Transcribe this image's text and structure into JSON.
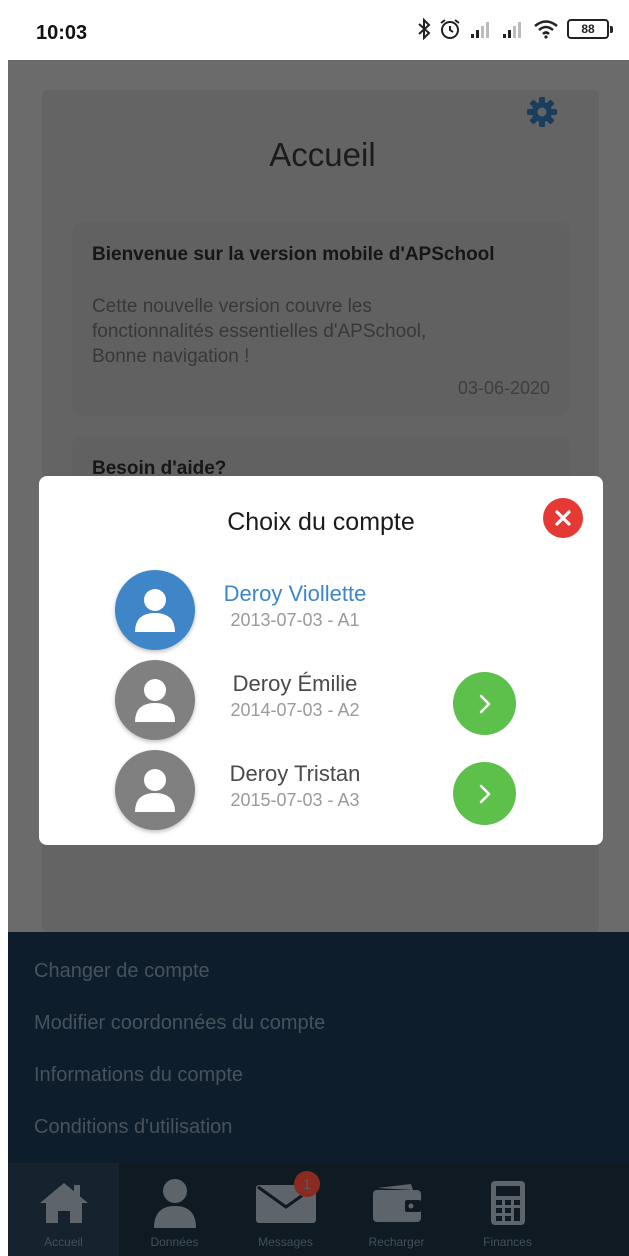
{
  "status_bar": {
    "time": "10:03",
    "battery": "88",
    "icons": [
      "bluetooth-icon",
      "alarm-icon",
      "signal-icon",
      "signal-icon",
      "wifi-icon",
      "battery-icon"
    ]
  },
  "home": {
    "title": "Accueil",
    "news": {
      "title": "Bienvenue sur la version mobile d'APSchool",
      "body_lines": [
        "Cette nouvelle version couvre les",
        "fonctionnalités essentielles d'APSchool,",
        "Bonne navigation !"
      ],
      "date": "03-06-2020"
    },
    "help": {
      "title": "Besoin d'aide?"
    }
  },
  "modal": {
    "title": "Choix du compte",
    "accounts": [
      {
        "name": "Deroy Viollette",
        "meta": "2013-07-03 - A1",
        "selected": true
      },
      {
        "name": "Deroy Émilie",
        "meta": "2014-07-03 - A2",
        "selected": false
      },
      {
        "name": "Deroy Tristan",
        "meta": "2015-07-03 - A3",
        "selected": false
      }
    ]
  },
  "menu": {
    "items": [
      "Changer de compte",
      "Modifier coordonnées du compte",
      "Informations du compte",
      "Conditions d'utilisation"
    ]
  },
  "tabs": [
    {
      "label": "Accueil",
      "icon": "home-icon"
    },
    {
      "label": "Données",
      "icon": "user-icon"
    },
    {
      "label": "Messages",
      "icon": "mail-icon",
      "badge": "1"
    },
    {
      "label": "Recharger",
      "icon": "wallet-icon"
    },
    {
      "label": "Finances",
      "icon": "calculator-icon"
    }
  ],
  "colors": {
    "accent": "#3f86c8",
    "confirm": "#5cc04a",
    "close": "#e53935",
    "avatar_inactive": "#808080"
  }
}
